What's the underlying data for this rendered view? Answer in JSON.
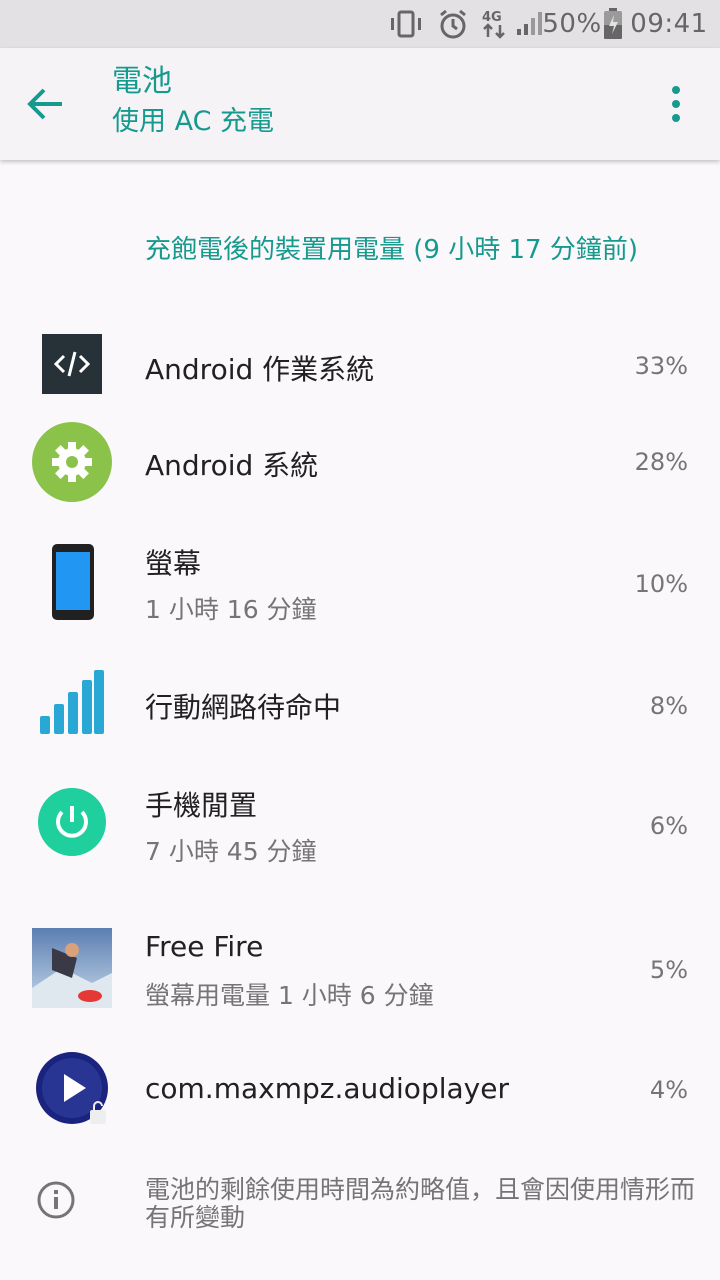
{
  "status_bar": {
    "battery_percent": "50%",
    "time": "09:41",
    "network": "4G",
    "icons": [
      "vibrate-icon",
      "alarm-icon",
      "data-icon",
      "signal-icon",
      "battery-charging-icon"
    ]
  },
  "header": {
    "title": "電池",
    "subtitle": "使用 AC 充電"
  },
  "section_title": "充飽電後的裝置用電量 (9 小時 17 分鐘前)",
  "items": [
    {
      "name": "Android 作業系統",
      "detail": "",
      "percent": "33%",
      "icon": "android-os-icon"
    },
    {
      "name": "Android 系統",
      "detail": "",
      "percent": "28%",
      "icon": "android-system-gear-icon"
    },
    {
      "name": "螢幕",
      "detail": "1 小時 16 分鐘",
      "percent": "10%",
      "icon": "phone-screen-icon"
    },
    {
      "name": "行動網路待命中",
      "detail": "",
      "percent": "8%",
      "icon": "cell-signal-icon"
    },
    {
      "name": "手機閒置",
      "detail": "7 小時 45 分鐘",
      "percent": "6%",
      "icon": "power-icon"
    },
    {
      "name": "Free Fire",
      "detail": "螢幕用電量 1 小時 6 分鐘",
      "percent": "5%",
      "icon": "free-fire-app-icon"
    },
    {
      "name": "com.maxmpz.audioplayer",
      "detail": "",
      "percent": "4%",
      "icon": "audio-player-icon"
    }
  ],
  "footer_info": "電池的剩餘使用時間為約略值，且會因使用情形而有所變動",
  "colors": {
    "accent": "#179a8e",
    "status_bar": "#e3e1e3",
    "appbar": "#f6f3f6",
    "background": "#fbf8fb"
  }
}
